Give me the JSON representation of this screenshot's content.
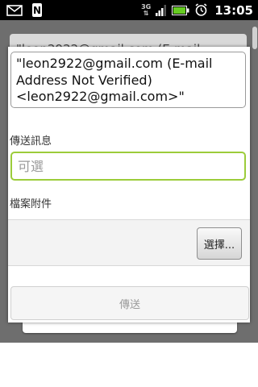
{
  "status_bar": {
    "time": "13:05",
    "network": "3G",
    "notification_letter": "N",
    "icons": [
      "mail-icon",
      "n-notification-icon",
      "network-3g-icon",
      "signal-icon",
      "battery-icon",
      "alarm-icon"
    ]
  },
  "background": {
    "partial_text": "\"leon2922@gmail.com (E-mail"
  },
  "dialog": {
    "recipient": "\"leon2922@gmail.com (E-mail Address Not Verified) <leon2922@gmail.com>\"",
    "message_label": "傳送訊息",
    "message_placeholder": "可選",
    "attachment_label": "檔案附件",
    "choose_button": "選擇...",
    "send_button": "傳送"
  },
  "colors": {
    "focus_border": "#9ccc3a",
    "overlay": "#6e6e6e",
    "status_bar": "#000000"
  }
}
